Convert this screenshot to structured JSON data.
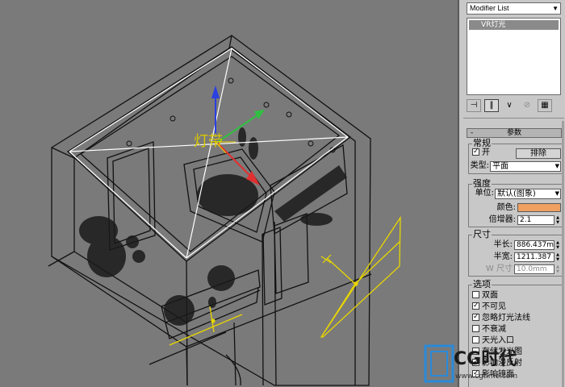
{
  "viewport": {
    "label": "灯带"
  },
  "modifier_panel": {
    "modifier_list": "Modifier List",
    "stack_item": "VR灯光",
    "toolbar_icons": [
      "pin-stack-icon",
      "show-end-result-icon",
      "make-unique-icon",
      "remove-modifier-icon",
      "configure-sets-icon"
    ]
  },
  "params": {
    "rollout_title": "参数",
    "general": {
      "title": "常规",
      "on_label": "开",
      "on_checked": true,
      "exclude_button": "排除",
      "type_label": "类型:",
      "type_value": "平面"
    },
    "intensity": {
      "title": "强度",
      "units_label": "单位:",
      "units_value": "默认(图象)",
      "color_label": "颜色:",
      "color_value": "#f0a060",
      "multiplier_label": "倍增器:",
      "multiplier_value": "2.1"
    },
    "size": {
      "title": "尺寸",
      "half_length_label": "半长:",
      "half_length_value": "886.437m",
      "half_width_label": "半宽:",
      "half_width_value": "1211.387",
      "w_size_label": "W 尺寸",
      "w_size_value": "10.0mm"
    },
    "options": {
      "title": "选项",
      "items": [
        {
          "label": "双面",
          "checked": false
        },
        {
          "label": "不可见",
          "checked": true
        },
        {
          "label": "忽略灯光法线",
          "checked": true
        },
        {
          "label": "不衰减",
          "checked": false
        },
        {
          "label": "天光入口",
          "checked": false
        },
        {
          "label": "存储发光图",
          "checked": false
        },
        {
          "label": "影响漫反射",
          "checked": true
        },
        {
          "label": "影响镜面",
          "checked": true
        }
      ]
    }
  },
  "watermark": {
    "text": "CG时代",
    "url": "www.cgtime.com"
  }
}
